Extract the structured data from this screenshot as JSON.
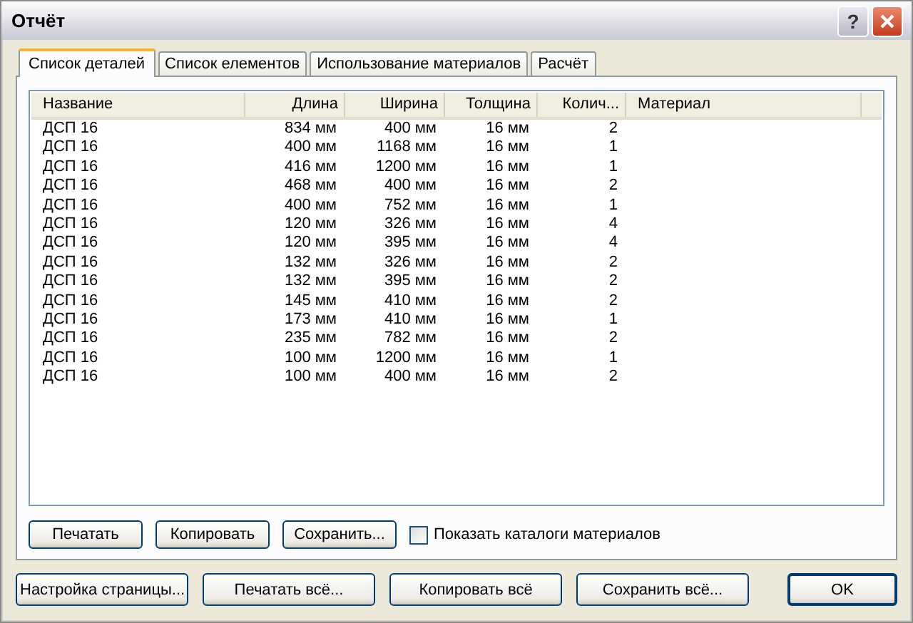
{
  "window": {
    "title": "Отчёт",
    "help_button": "?"
  },
  "tabs": [
    {
      "label": "Список деталей",
      "selected": true
    },
    {
      "label": "Список елементов",
      "selected": false
    },
    {
      "label": "Использование материалов",
      "selected": false
    },
    {
      "label": "Расчёт",
      "selected": false
    }
  ],
  "table": {
    "columns": [
      "Название",
      "Длина",
      "Ширина",
      "Толщина",
      "Колич...",
      "Материал"
    ],
    "rows": [
      [
        "ДСП 16",
        "834 мм",
        "400 мм",
        "16 мм",
        "2"
      ],
      [
        "ДСП 16",
        "400 мм",
        "1168 мм",
        "16 мм",
        "1"
      ],
      [
        "ДСП 16",
        "416 мм",
        "1200 мм",
        "16 мм",
        "1"
      ],
      [
        "ДСП 16",
        "468 мм",
        "400 мм",
        "16 мм",
        "2"
      ],
      [
        "ДСП 16",
        "400 мм",
        "752 мм",
        "16 мм",
        "1"
      ],
      [
        "ДСП 16",
        "120 мм",
        "326 мм",
        "16 мм",
        "4"
      ],
      [
        "ДСП 16",
        "120 мм",
        "395 мм",
        "16 мм",
        "4"
      ],
      [
        "ДСП 16",
        "132 мм",
        "326 мм",
        "16 мм",
        "2"
      ],
      [
        "ДСП 16",
        "132 мм",
        "395 мм",
        "16 мм",
        "2"
      ],
      [
        "ДСП 16",
        "145 мм",
        "410 мм",
        "16 мм",
        "2"
      ],
      [
        "ДСП 16",
        "173 мм",
        "410 мм",
        "16 мм",
        "1"
      ],
      [
        "ДСП 16",
        "235 мм",
        "782 мм",
        "16 мм",
        "2"
      ],
      [
        "ДСП 16",
        "100 мм",
        "1200 мм",
        "16 мм",
        "1"
      ],
      [
        "ДСП 16",
        "100 мм",
        "400 мм",
        "16 мм",
        "2"
      ]
    ]
  },
  "tab_buttons": [
    "Печатать",
    "Копировать",
    "Сохранить..."
  ],
  "show_catalogs": {
    "label": "Показать каталоги материалов",
    "checked": false
  },
  "bottom_buttons": [
    "Настройка страницы...",
    "Печатать всё...",
    "Копировать всё",
    "Сохранить всё..."
  ],
  "ok_button": "OK"
}
